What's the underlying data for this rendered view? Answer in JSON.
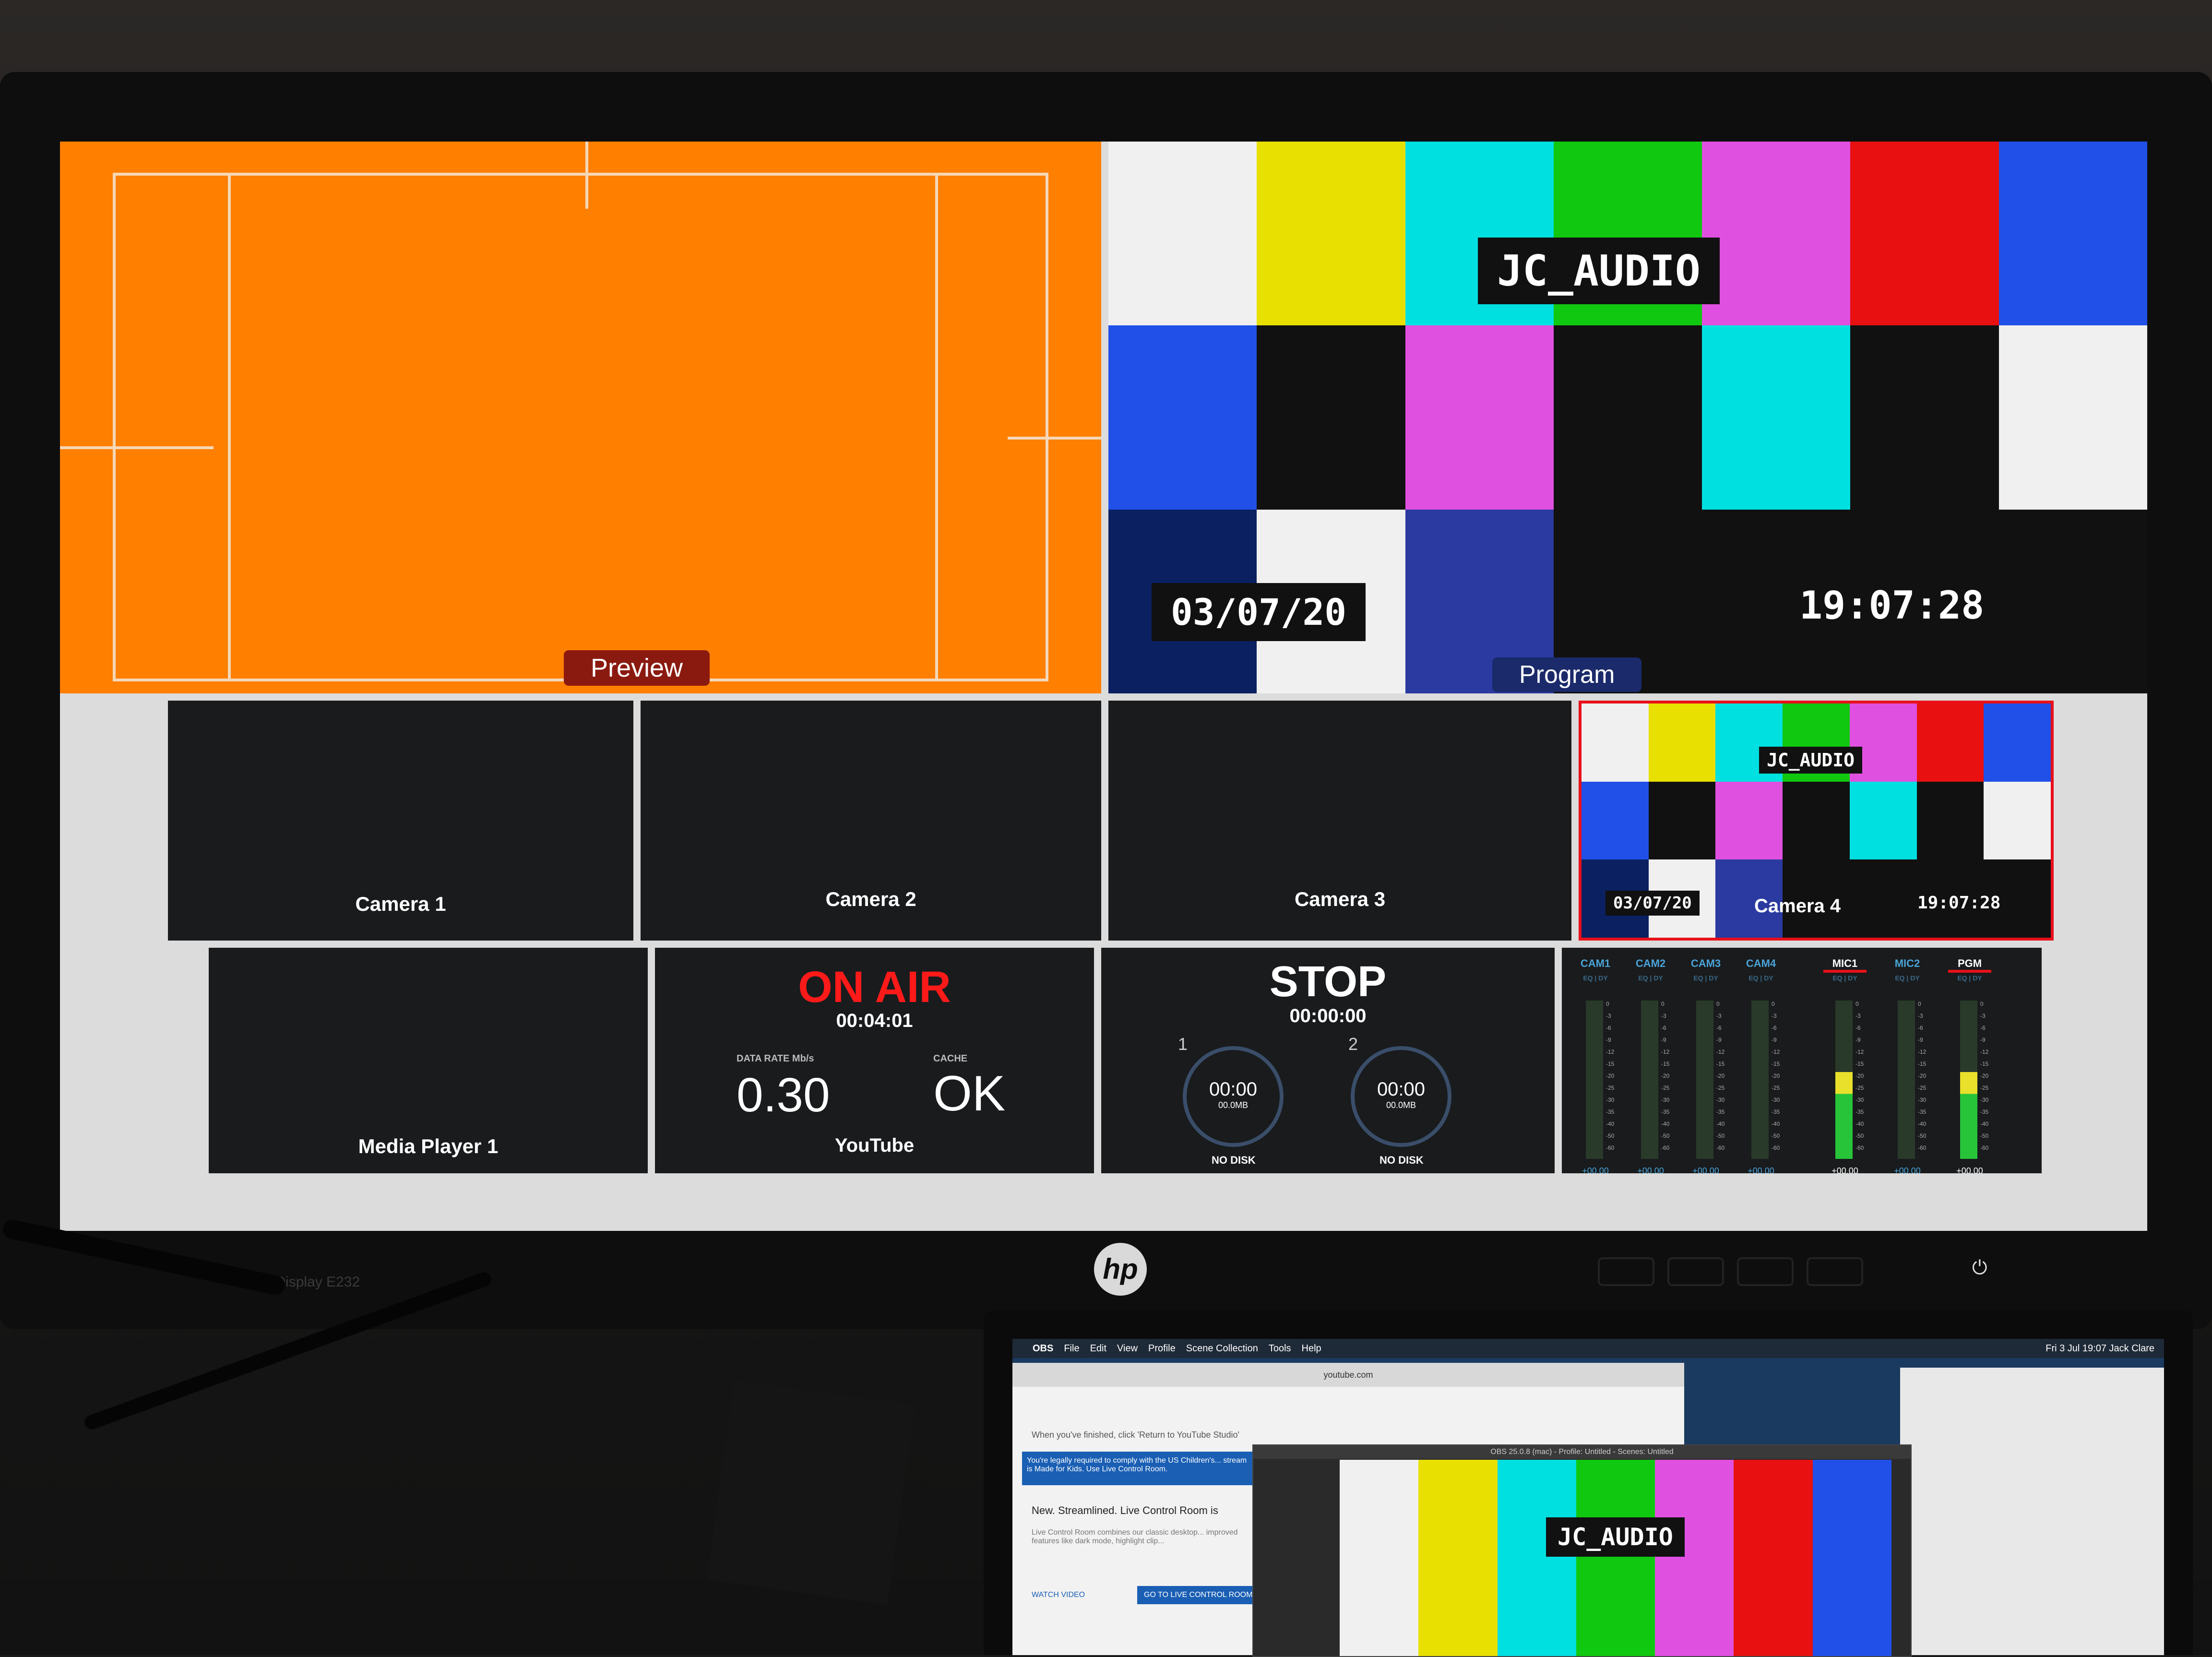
{
  "monitor": {
    "model": "EliteDisplay E232",
    "brand": "hp"
  },
  "multiview": {
    "preview": {
      "label": "Preview",
      "background": "#ff7f00"
    },
    "program": {
      "label": "Program",
      "overlay_title": "JC_AUDIO",
      "date": "03/07/20",
      "time": "19:07:28"
    },
    "cameras": [
      {
        "label": "Camera 1"
      },
      {
        "label": "Camera 2"
      },
      {
        "label": "Camera 3"
      },
      {
        "label": "Camera 4",
        "overlay_title": "JC_AUDIO",
        "date": "03/07/20",
        "time": "19:07:28"
      }
    ],
    "media_player": {
      "label": "Media Player 1"
    },
    "stream": {
      "status": "ON AIR",
      "duration": "00:04:01",
      "datarate_label": "DATA RATE Mb/s",
      "datarate_value": "0.30",
      "cache_label": "CACHE",
      "cache_value": "OK",
      "platform": "YouTube"
    },
    "record": {
      "status": "STOP",
      "duration": "00:00:00",
      "disks": [
        {
          "number": "1",
          "time": "00:00",
          "size": "00.0MB",
          "status": "NO DISK"
        },
        {
          "number": "2",
          "time": "00:00",
          "size": "00.0MB",
          "status": "NO DISK"
        }
      ]
    },
    "audio": {
      "channels": [
        {
          "name": "CAM1",
          "sub": "EQ | DY",
          "value": "+00.00",
          "level": 0.0
        },
        {
          "name": "CAM2",
          "sub": "EQ | DY",
          "value": "+00.00",
          "level": 0.0
        },
        {
          "name": "CAM3",
          "sub": "EQ | DY",
          "value": "+00.00",
          "level": 0.0
        },
        {
          "name": "CAM4",
          "sub": "EQ | DY",
          "value": "+00.00",
          "level": 0.0
        },
        {
          "name": "MIC1",
          "sub": "EQ | DY",
          "value": "+00.00",
          "level": 0.55
        },
        {
          "name": "MIC2",
          "sub": "EQ | DY",
          "value": "+00.00",
          "level": 0.0
        },
        {
          "name": "PGM",
          "sub": "EQ | DY",
          "value": "+00.00",
          "level": 0.55
        }
      ],
      "scale": [
        "0",
        "-3",
        "-6",
        "-9",
        "-12",
        "-15",
        "-20",
        "-25",
        "-30",
        "-35",
        "-40",
        "-50",
        "-60"
      ]
    }
  },
  "laptop": {
    "menu": [
      "OBS",
      "File",
      "Edit",
      "View",
      "Profile",
      "Scene Collection",
      "Tools",
      "Help"
    ],
    "menu_right": "Fri 3 Jul 19:07   Jack Clare",
    "browser_url": "youtube.com",
    "browser_text1": "When you've finished, click 'Return to YouTube Studio'",
    "browser_text2": "You're legally required to comply with the US Children's... stream is Made for Kids. Use Live Control Room.",
    "browser_heading": "New. Streamlined. Live Control Room is",
    "browser_body": "Live Control Room combines our classic desktop... improved features like dark mode, highlight clip...",
    "watch_video": "WATCH VIDEO",
    "go_button": "GO TO LIVE CONTROL ROOM",
    "obs_title": "OBS 25.0.8 (mac) - Profile: Untitled - Scenes: Untitled",
    "obs_overlay": "JC_AUDIO"
  },
  "colors": {
    "tally_red": "#8a1a10",
    "program_blue": "#1a2a6a",
    "on_air_red": "#ff1a1a",
    "meter_green": "#27c43a",
    "meter_yellow": "#e8e02a"
  }
}
